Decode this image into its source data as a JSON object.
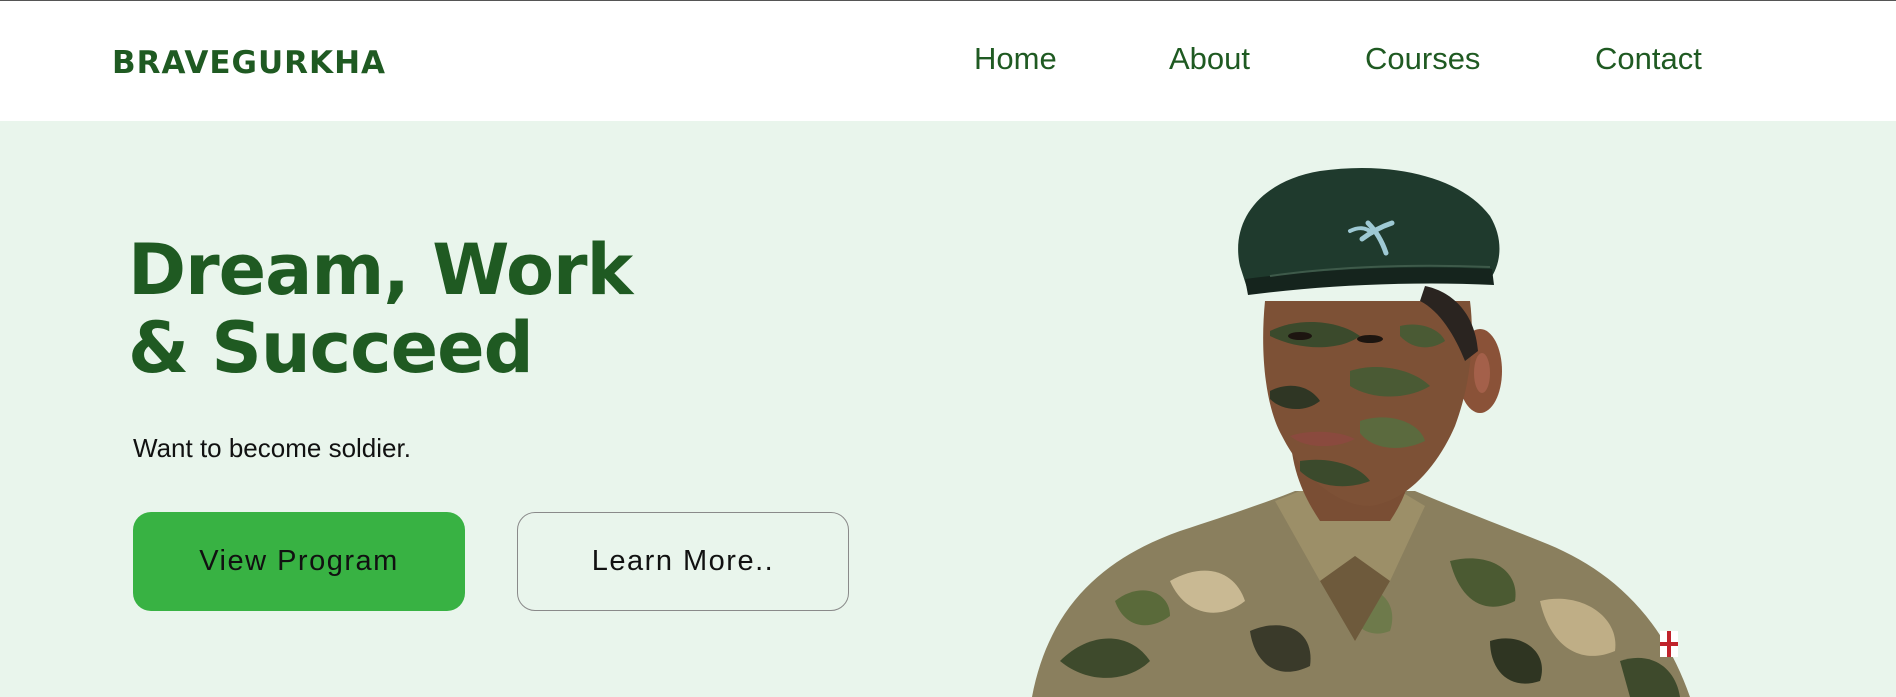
{
  "brand": {
    "logo_text": "BRAVEGURKHA",
    "primary_color": "#1f5a22",
    "accent_color": "#38b243",
    "hero_bg": "#e9f5ec"
  },
  "nav": {
    "items": [
      {
        "label": "Home"
      },
      {
        "label": "About"
      },
      {
        "label": "Courses"
      },
      {
        "label": "Contact"
      }
    ]
  },
  "hero": {
    "headline_line1": "Dream, Work",
    "headline_line2": "& Succeed",
    "subtitle": "Want to become soldier.",
    "primary_button": "View Program",
    "secondary_button": "Learn More..",
    "image_icon": "soldier-portrait"
  }
}
